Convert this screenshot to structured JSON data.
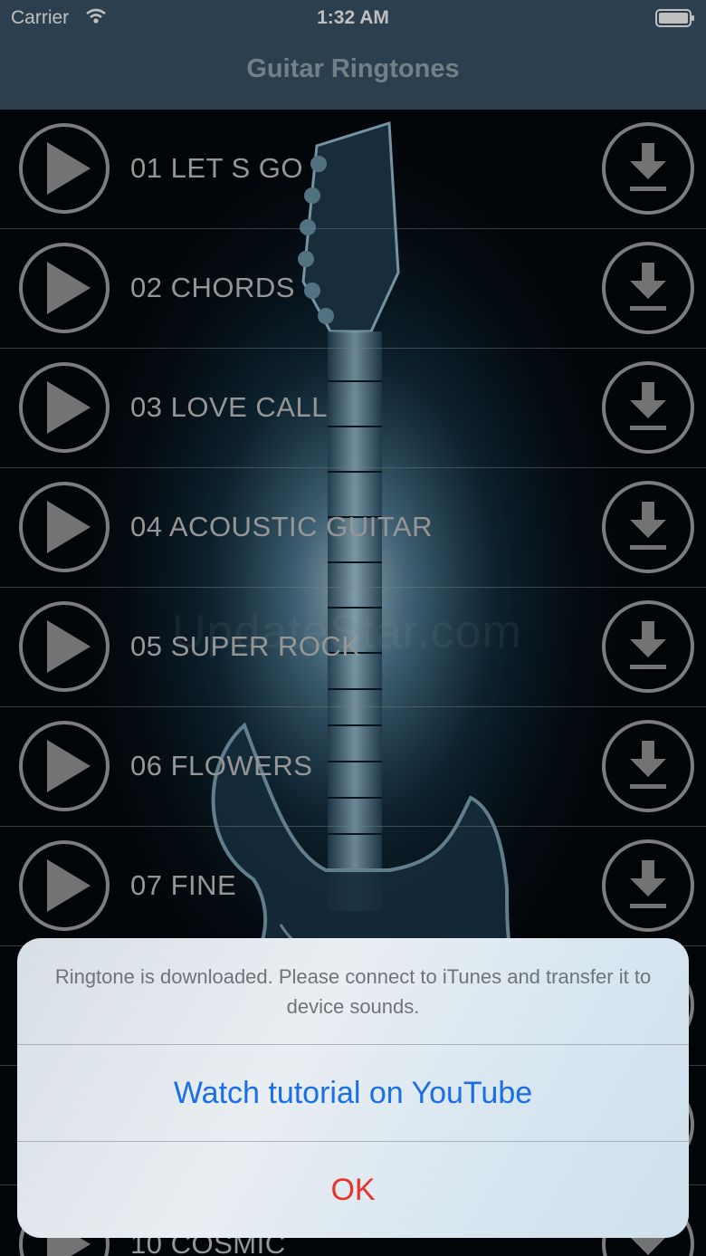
{
  "status_bar": {
    "carrier": "Carrier",
    "time": "1:32 AM"
  },
  "nav": {
    "title": "Guitar Ringtones"
  },
  "watermark": "UpdateStar.com",
  "ringtones": [
    {
      "title": "01 LET S GO"
    },
    {
      "title": "02 CHORDS"
    },
    {
      "title": "03 LOVE CALL"
    },
    {
      "title": "04 ACOUSTIC GUITAR"
    },
    {
      "title": "05 SUPER ROCK"
    },
    {
      "title": "06 FLOWERS"
    },
    {
      "title": "07 FINE"
    },
    {
      "title": ""
    },
    {
      "title": ""
    },
    {
      "title": "10 COSMIC"
    }
  ],
  "alert": {
    "message": "Ringtone is downloaded. Please connect to iTunes and transfer it to device sounds.",
    "buttons": {
      "youtube": "Watch tutorial on YouTube",
      "ok": "OK"
    }
  },
  "icons": {
    "play": "play-icon",
    "download": "download-icon",
    "wifi": "wifi-icon",
    "battery": "battery-icon"
  },
  "colors": {
    "header": "#3a5568",
    "nav_title": "#9aabb6",
    "alert_link": "#1a6ee6",
    "alert_destructive": "#e8332a"
  }
}
